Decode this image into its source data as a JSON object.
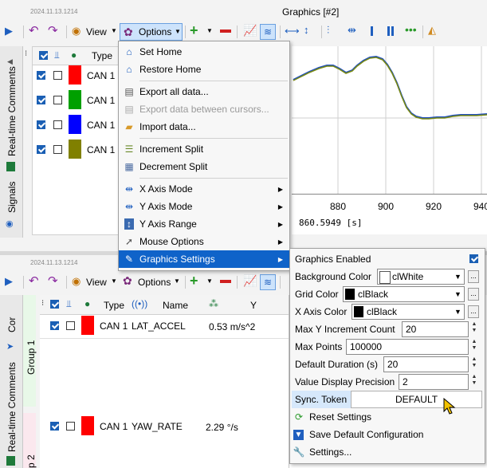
{
  "top_window": {
    "timestamp": "2024.11.13.1214",
    "title": "Graphics [#2]",
    "view_label": "View",
    "options_label": "Options",
    "side_tab_comments": "Real-time Comments",
    "side_tab_signals": "Signals",
    "columns": {
      "type": "Type"
    },
    "rows": [
      {
        "label": "CAN 1",
        "color": "#ff0000",
        "checked": true
      },
      {
        "label": "CAN 1",
        "color": "#00a000",
        "checked": true
      },
      {
        "label": "CAN 1",
        "color": "#0000ff",
        "checked": true
      },
      {
        "label": "CAN 1",
        "color": "#808000",
        "checked": true
      }
    ],
    "x_ticks": [
      "880",
      "900",
      "920",
      "940"
    ],
    "cursor_readout": "860.5949 [s]"
  },
  "bottom_window": {
    "timestamp": "2024.11.13.1214",
    "view_label": "View",
    "options_label": "Options",
    "side_tab_cor": "Cor",
    "side_tab_comments": "Real-time Comments",
    "group1_label": "Group 1",
    "group2_label": "p 2",
    "columns": {
      "type": "Type",
      "name": "Name",
      "y": "Y"
    },
    "rows": [
      {
        "type": "CAN 1",
        "name": "LAT_ACCEL",
        "value": "0.53 m/s^2",
        "color": "#ff0000"
      },
      {
        "type": "CAN 1",
        "name": "YAW_RATE",
        "value": "2.29 °/s",
        "color": "#ff0000"
      }
    ]
  },
  "options_menu": {
    "items": [
      {
        "label": "Set Home",
        "icon": "home-icon",
        "disabled": false,
        "submenu": false
      },
      {
        "label": "Restore Home",
        "icon": "restore-home-icon",
        "disabled": false,
        "submenu": false
      },
      {
        "label": "Export all data...",
        "icon": "export-icon",
        "disabled": false,
        "submenu": false
      },
      {
        "label": "Export data between cursors...",
        "icon": "export-cursors-icon",
        "disabled": true,
        "submenu": false
      },
      {
        "label": "Import data...",
        "icon": "folder-icon",
        "disabled": false,
        "submenu": false
      },
      {
        "label": "Increment Split",
        "icon": "increment-split-icon",
        "disabled": false,
        "submenu": false
      },
      {
        "label": "Decrement Split",
        "icon": "decrement-split-icon",
        "disabled": false,
        "submenu": false
      },
      {
        "label": "X Axis Mode",
        "icon": "x-axis-icon",
        "disabled": false,
        "submenu": true
      },
      {
        "label": "Y Axis Mode",
        "icon": "y-axis-icon",
        "disabled": false,
        "submenu": true
      },
      {
        "label": "Y Axis Range",
        "icon": "y-range-icon",
        "disabled": false,
        "submenu": true
      },
      {
        "label": "Mouse Options",
        "icon": "mouse-icon",
        "disabled": false,
        "submenu": true
      },
      {
        "label": "Graphics Settings",
        "icon": "pencil-icon",
        "disabled": false,
        "submenu": true,
        "highlighted": true
      }
    ]
  },
  "graphics_settings": {
    "enabled_label": "Graphics Enabled",
    "enabled": true,
    "background_color_label": "Background Color",
    "background_color_value": "clWhite",
    "background_swatch": "#ffffff",
    "grid_color_label": "Grid Color",
    "grid_color_value": "clBlack",
    "grid_swatch": "#000000",
    "x_axis_color_label": "X Axis Color",
    "x_axis_color_value": "clBlack",
    "x_axis_swatch": "#000000",
    "max_y_increment_label": "Max Y Increment Count",
    "max_y_increment_value": "20",
    "max_points_label": "Max Points",
    "max_points_value": "100000",
    "default_duration_label": "Default Duration (s)",
    "default_duration_value": "20",
    "precision_label": "Value Display Precision",
    "precision_value": "2",
    "sync_token_label": "Sync. Token",
    "sync_token_value": "DEFAULT",
    "reset_label": "Reset Settings",
    "save_default_label": "Save Default Configuration",
    "settings_label": "Settings...",
    "ellipsis": "..."
  },
  "colors": {
    "accent": "#0f63c9",
    "graph_series_1": "#1f4fbf",
    "graph_series_2": "#7a8a10"
  }
}
